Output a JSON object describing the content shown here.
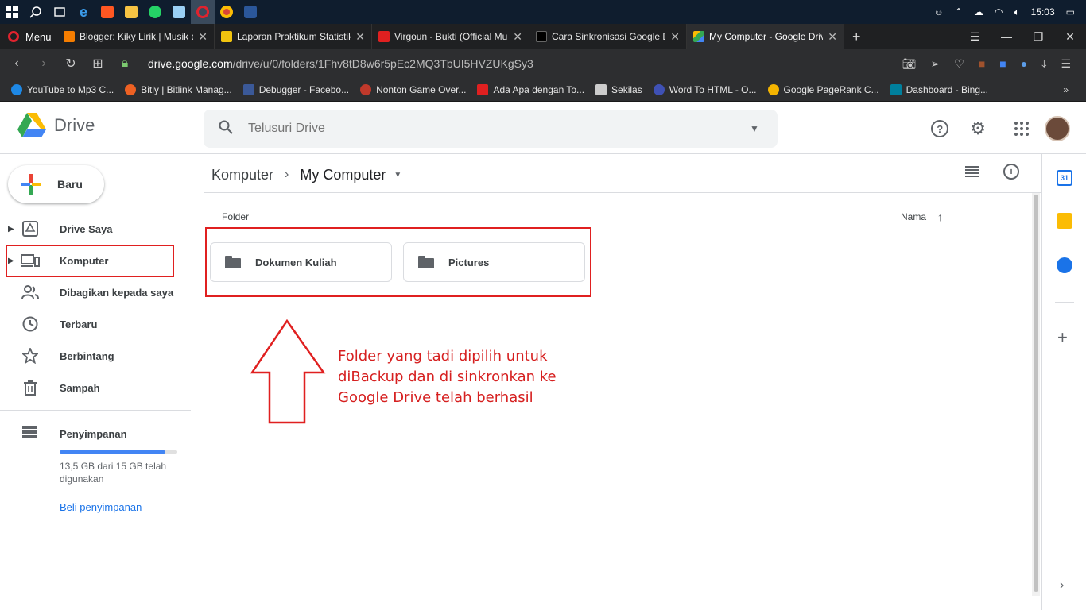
{
  "taskbar": {
    "clock": "15:03",
    "apps": [
      "windows-start",
      "search",
      "task-view",
      "edge",
      "app-red",
      "file-explorer",
      "whatsapp",
      "notepad",
      "opera",
      "chrome",
      "word"
    ]
  },
  "tabs": {
    "menu_label": "Menu",
    "items": [
      {
        "title": "Blogger: Kiky Lirik | Musik d",
        "color": "#f57d00"
      },
      {
        "title": "Laporan Praktikum Statistik",
        "color": "#f1c40f"
      },
      {
        "title": "Virgoun - Bukti (Official Mu",
        "color": "#e02020"
      },
      {
        "title": "Cara Sinkronisasi Google D",
        "color": "#000000"
      },
      {
        "title": "My Computer - Google Driv",
        "color": "#34a853"
      }
    ]
  },
  "address": {
    "domain": "drive.google.com",
    "path": "/drive/u/0/folders/1Fhv8tD8w6r5pEc2MQ3TbUI5HVZUKgSy3"
  },
  "bookmarks": {
    "items": [
      {
        "label": "YouTube to Mp3 C...",
        "color": "#1e88e5"
      },
      {
        "label": "Bitly | Bitlink Manag...",
        "color": "#ee6123"
      },
      {
        "label": "Debugger - Facebo...",
        "color": "#3b5998"
      },
      {
        "label": "Nonton Game Over...",
        "color": "#c0392b"
      },
      {
        "label": "Ada Apa dengan To...",
        "color": "#e02020"
      },
      {
        "label": "Sekilas",
        "color": "#cccccc"
      },
      {
        "label": "Word To HTML - O...",
        "color": "#3f51b5"
      },
      {
        "label": "Google PageRank C...",
        "color": "#f4b400"
      },
      {
        "label": "Dashboard - Bing...",
        "color": "#00809d"
      }
    ],
    "more": "»"
  },
  "header": {
    "app_name": "Drive",
    "search_placeholder": "Telusuri Drive"
  },
  "sidebar": {
    "new_label": "Baru",
    "items": [
      {
        "label": "Drive Saya"
      },
      {
        "label": "Komputer"
      },
      {
        "label": "Dibagikan kepada saya"
      },
      {
        "label": "Terbaru"
      },
      {
        "label": "Berbintang"
      },
      {
        "label": "Sampah"
      }
    ],
    "storage": {
      "label": "Penyimpanan",
      "usage_text": "13,5 GB dari 15 GB telah digunakan",
      "used_fraction": 0.9,
      "buy_label": "Beli penyimpanan"
    }
  },
  "main": {
    "breadcrumb": {
      "parent": "Komputer",
      "current": "My Computer"
    },
    "section_label": "Folder",
    "sort_label": "Nama",
    "folders": [
      {
        "name": "Dokumen Kuliah"
      },
      {
        "name": "Pictures"
      }
    ]
  },
  "annotation": {
    "note": "Folder yang tadi dipilih untuk diBackup dan di sinkronkan ke Google Drive telah berhasil",
    "color": "#d62020"
  },
  "sidepanel": {
    "apps": [
      {
        "name": "calendar",
        "color": "#1a73e8",
        "label": "31"
      },
      {
        "name": "keep",
        "color": "#fbbc04"
      },
      {
        "name": "tasks",
        "color": "#1a73e8"
      }
    ]
  }
}
